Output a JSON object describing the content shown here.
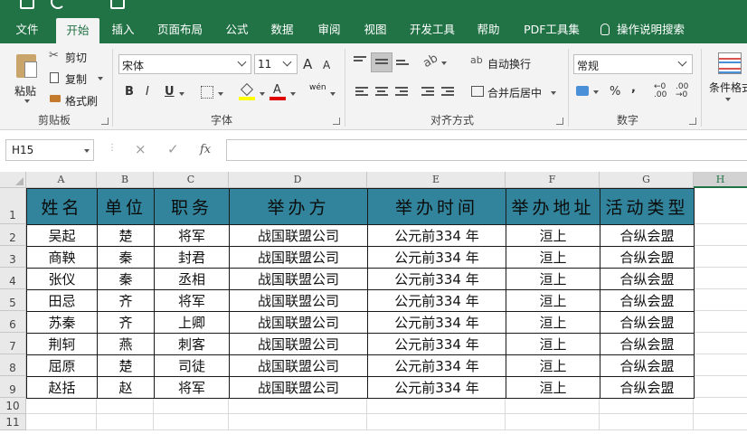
{
  "ribbon_tabs": [
    "文件",
    "开始",
    "插入",
    "页面布局",
    "公式",
    "数据",
    "审阅",
    "视图",
    "开发工具",
    "帮助",
    "PDF工具集",
    "操作说明搜索"
  ],
  "active_tab": "开始",
  "clipboard": {
    "paste": "粘贴",
    "cut": "剪切",
    "copy": "复制",
    "format_painter": "格式刷",
    "group": "剪贴板"
  },
  "font": {
    "name": "宋体",
    "size": "11",
    "bold": "B",
    "italic": "I",
    "underline": "U",
    "grow": "A",
    "shrink": "A",
    "phonetic": "wén",
    "group": "字体"
  },
  "alignment": {
    "wrap_text": "自动换行",
    "merge_center": "合并后居中",
    "group": "对齐方式"
  },
  "number": {
    "format": "常规",
    "percent": "%",
    "comma": ",",
    "group": "数字"
  },
  "styles": {
    "conditional": "条件格式"
  },
  "formula_bar": {
    "name_box": "H15",
    "cancel": "×",
    "enter": "✓",
    "fx": "fx",
    "formula": ""
  },
  "columns": [
    "A",
    "B",
    "C",
    "D",
    "E",
    "F",
    "G",
    "H"
  ],
  "selected_column": "H",
  "rows": [
    "1",
    "2",
    "3",
    "4",
    "5",
    "6",
    "7",
    "8",
    "9",
    "10",
    "11"
  ],
  "table": {
    "headers": [
      "姓名",
      "单位",
      "职务",
      "举办方",
      "举办时间",
      "举办地址",
      "活动类型"
    ],
    "header_fill": "#31849B",
    "rows": [
      [
        "吴起",
        "楚",
        "将军",
        "战国联盟公司",
        "公元前334 年",
        "洹上",
        "合纵会盟"
      ],
      [
        "商鞅",
        "秦",
        "封君",
        "战国联盟公司",
        "公元前334 年",
        "洹上",
        "合纵会盟"
      ],
      [
        "张仪",
        "秦",
        "丞相",
        "战国联盟公司",
        "公元前334 年",
        "洹上",
        "合纵会盟"
      ],
      [
        "田忌",
        "齐",
        "将军",
        "战国联盟公司",
        "公元前334 年",
        "洹上",
        "合纵会盟"
      ],
      [
        "苏秦",
        "齐",
        "上卿",
        "战国联盟公司",
        "公元前334 年",
        "洹上",
        "合纵会盟"
      ],
      [
        "荆轲",
        "燕",
        "刺客",
        "战国联盟公司",
        "公元前334 年",
        "洹上",
        "合纵会盟"
      ],
      [
        "屈原",
        "楚",
        "司徒",
        "战国联盟公司",
        "公元前334 年",
        "洹上",
        "合纵会盟"
      ],
      [
        "赵括",
        "赵",
        "将军",
        "战国联盟公司",
        "公元前334 年",
        "洹上",
        "合纵会盟"
      ]
    ]
  },
  "accent_color": "#217346"
}
